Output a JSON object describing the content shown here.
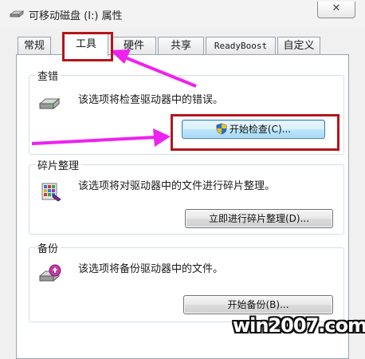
{
  "window": {
    "title": "可移动磁盘 (I:) 属性",
    "close_label": "✕"
  },
  "tabs": [
    {
      "label": "常规",
      "active": false
    },
    {
      "label": "工具",
      "active": true
    },
    {
      "label": "硬件",
      "active": false
    },
    {
      "label": "共享",
      "active": false
    },
    {
      "label": "ReadyBoost",
      "active": false
    },
    {
      "label": "自定义",
      "active": false
    }
  ],
  "groups": {
    "error_check": {
      "title": "查错",
      "description": "该选项将检查驱动器中的错误。",
      "button_label": "开始检查(C)...",
      "icon": "drive-icon"
    },
    "defrag": {
      "title": "碎片整理",
      "description": "该选项将对驱动器中的文件进行碎片整理。",
      "button_label": "立即进行碎片整理(D)...",
      "icon": "defrag-icon"
    },
    "backup": {
      "title": "备份",
      "description": "该选项将备份驱动器中的文件。",
      "button_label": "开始备份(B)...",
      "icon": "backup-icon"
    }
  },
  "annotations": {
    "highlight_color": "#b4151d",
    "arrow_color": "#ee22ee"
  },
  "watermark": "win2007.com"
}
